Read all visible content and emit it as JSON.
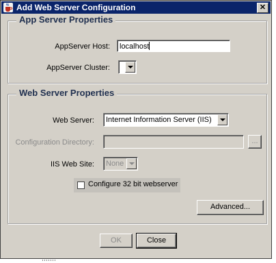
{
  "window": {
    "title": "Add Web Server Configuration",
    "close_glyph": "✕"
  },
  "app_server": {
    "group_title": "App Server Properties",
    "host_label": "AppServer Host:",
    "host_value": "localhost",
    "cluster_label": "AppServer Cluster:",
    "cluster_value": ""
  },
  "web_server": {
    "group_title": "Web Server Properties",
    "server_label": "Web Server:",
    "server_value": "Internet Information Server (IIS)",
    "config_dir_label": "Configuration Directory:",
    "config_dir_value": "",
    "browse_label": "...",
    "iis_site_label": "IIS Web Site:",
    "iis_site_value": "None",
    "checkbox_label": "Configure 32 bit webserver",
    "checkbox_checked": false,
    "advanced_label": "Advanced..."
  },
  "footer": {
    "ok_label": "OK",
    "close_label": "Close"
  },
  "colors": {
    "titlebar": "#0a246a",
    "dialog_bg": "#d4d0c8",
    "group_title": "#1f2f4f",
    "disabled_text": "#8a8a8a"
  },
  "icons": {
    "title": "java-cup-icon",
    "close": "close-icon",
    "dropdown": "chevron-down-icon"
  }
}
